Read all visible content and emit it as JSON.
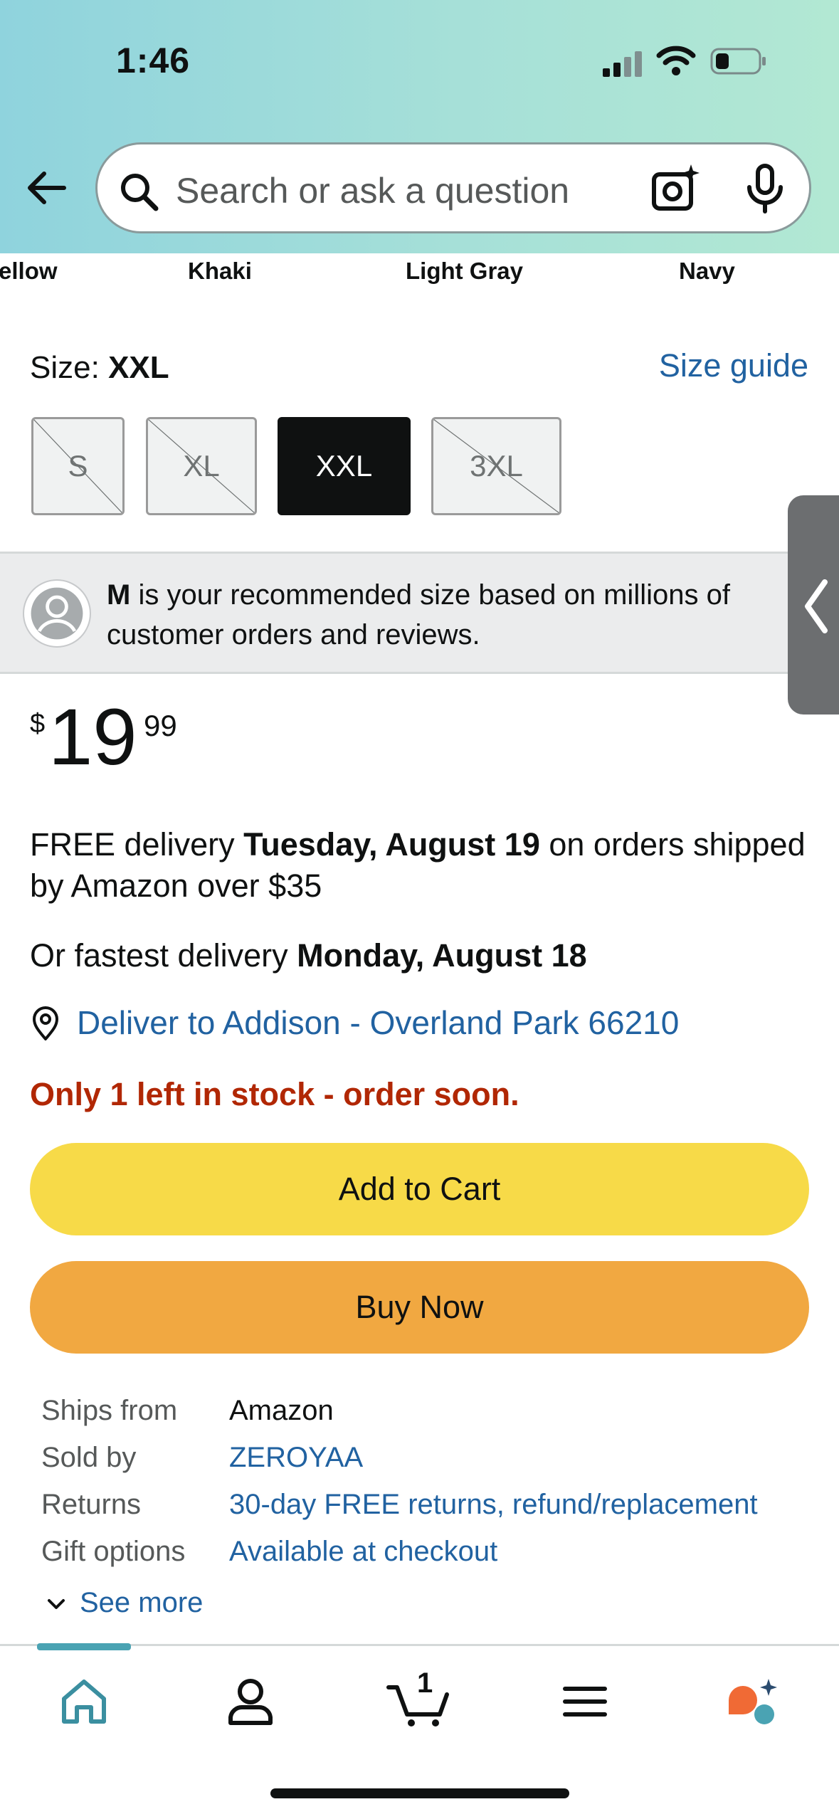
{
  "status_bar": {
    "time": "1:46"
  },
  "search": {
    "placeholder": "Search or ask a question"
  },
  "colors": {
    "visible_names": [
      "ellow",
      "Khaki",
      "Light Gray",
      "Navy"
    ]
  },
  "size": {
    "label": "Size:",
    "selected": "XXL",
    "guide_link": "Size guide",
    "options": [
      {
        "label": "S",
        "available": false,
        "selected": false
      },
      {
        "label": "XL",
        "available": false,
        "selected": false
      },
      {
        "label": "XXL",
        "available": true,
        "selected": true
      },
      {
        "label": "3XL",
        "available": false,
        "selected": false
      }
    ]
  },
  "recommendation": {
    "size": "M",
    "text": " is your recommended size based on millions of customer orders and reviews."
  },
  "price": {
    "symbol": "$",
    "whole": "19",
    "fraction": "99"
  },
  "delivery": {
    "free_prefix": "FREE delivery ",
    "free_date": "Tuesday, August 19",
    "free_suffix": " on orders shipped by Amazon over $35",
    "fast_prefix": "Or fastest delivery ",
    "fast_date": "Monday, August 18",
    "deliver_to": "Deliver to Addison - Overland Park 66210"
  },
  "stock_message": "Only 1 left in stock - order soon.",
  "buttons": {
    "add_to_cart": "Add to Cart",
    "buy_now": "Buy Now"
  },
  "details": [
    {
      "key": "Ships from",
      "value": "Amazon",
      "link": false
    },
    {
      "key": "Sold by",
      "value": "ZEROYAA",
      "link": true
    },
    {
      "key": "Returns",
      "value": "30-day FREE returns, refund/replacement",
      "link": true
    },
    {
      "key": "Gift options",
      "value": "Available at checkout",
      "link": true
    }
  ],
  "see_more": "See more",
  "bottom_nav": {
    "items": [
      "home-icon",
      "account-icon",
      "cart-icon",
      "menu-icon",
      "rufus-icon"
    ],
    "cart_count": "1",
    "active": "home"
  },
  "theme": {
    "link": "#2162a1",
    "stock_red": "#b12704",
    "cart_yellow": "#f7da48",
    "buy_orange": "#f1a841"
  }
}
